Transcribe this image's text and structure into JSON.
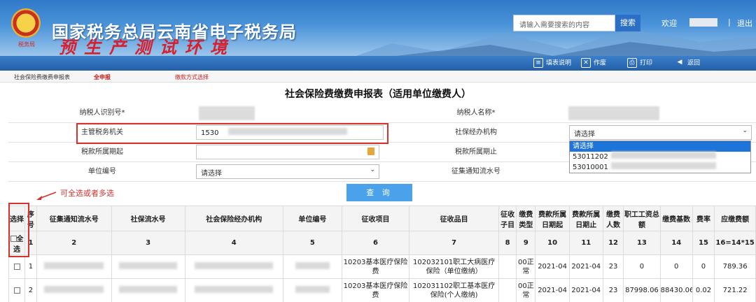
{
  "header": {
    "site_title": "国家税务总局云南省电子税务局",
    "env_title": "预生产测试环境",
    "search_placeholder": "请输入需要搜索的内容",
    "search_button": "搜索",
    "welcome": "欢迎",
    "logout": "退出"
  },
  "toolbar": {
    "help": "填表说明",
    "void": "作废",
    "print": "打印",
    "back": "返回"
  },
  "breadcrumb": {
    "page": "社会保险费缴费申报表",
    "declare_all": "全申报",
    "payment_method": "缴款方式选择"
  },
  "form": {
    "title": "社会保险费缴费申报表（适用单位缴费人）",
    "taxpayer_id_label": "纳税人识别号*",
    "taxpayer_name_label": "纳税人名称*",
    "tax_authority_label": "主管税务机关",
    "tax_authority_value": "1530",
    "social_agency_label": "社保经办机构",
    "social_agency_value": "请选择",
    "period_start_label": "税款所属期起",
    "period_end_label": "税款所属期止",
    "unit_no_label": "单位编号",
    "unit_no_value": "请选择",
    "notice_no_label": "征集通知流水号",
    "dropdown_options": [
      "请选择",
      "53011202",
      "53010001"
    ],
    "query_button": "查 询",
    "annotation": "可全选或者多选"
  },
  "table": {
    "headers": [
      "选择",
      "序号",
      "征集通知流水号",
      "社保流水号",
      "社会保险经办机构",
      "单位编号",
      "征收项目",
      "征收品目",
      "征收子目",
      "缴费类型",
      "费款所属日期起",
      "费款所属日期止",
      "缴费人数",
      "职工工资总额",
      "缴费基数",
      "费率",
      "应缴费额"
    ],
    "select_all": "全选",
    "numbers": [
      "1",
      "2",
      "3",
      "4",
      "5",
      "6",
      "7",
      "8",
      "9",
      "10",
      "11",
      "12",
      "13",
      "14",
      "15",
      "16=14*15"
    ],
    "rows": [
      {
        "seq": "1",
        "item": "10203基本医疗保险费",
        "subitem": "102032101职工大病医疗保险（单位缴纳）",
        "type": "00正常",
        "start": "2021-04",
        "end": "2021-04",
        "count": "23",
        "wage": "0",
        "base": "0",
        "rate": "0",
        "amount": "789.36"
      },
      {
        "seq": "2",
        "item": "10203基本医疗保险费",
        "subitem": "102031102职工基本医疗保险(个人缴纳)",
        "type": "00正常",
        "start": "2021-04",
        "end": "2021-04",
        "count": "23",
        "wage": "87998.06",
        "base": "88430.06",
        "rate": "0.02",
        "amount": "721.22"
      }
    ]
  }
}
